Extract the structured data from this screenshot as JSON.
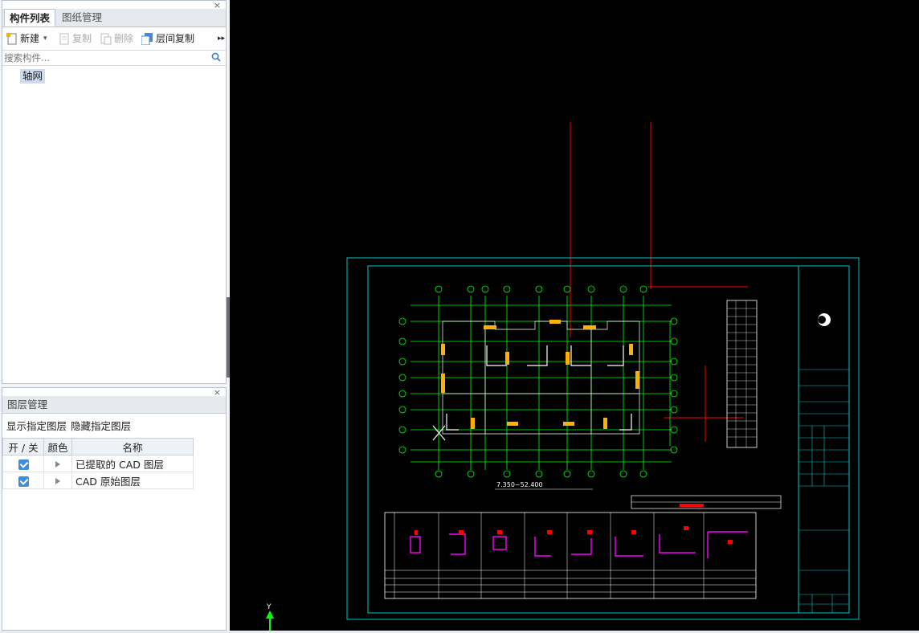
{
  "component_panel": {
    "close": "×",
    "tabs": [
      {
        "label": "构件列表",
        "active": true
      },
      {
        "label": "图纸管理",
        "active": false
      }
    ],
    "toolbar": {
      "new_label": "新建",
      "new_dropdown": "▾",
      "copy_label": "复制",
      "delete_label": "删除",
      "floor_copy_label": "层间复制",
      "more": "▸▸"
    },
    "search": {
      "placeholder": "搜索构件...",
      "value": ""
    },
    "tree": [
      {
        "label": "轴网",
        "selected": true
      }
    ]
  },
  "layer_panel": {
    "close": "×",
    "title": "图层管理",
    "show_label": "显示指定图层",
    "hide_label": "隐藏指定图层",
    "columns": [
      "开 / 关",
      "颜色",
      "名称"
    ],
    "rows": [
      {
        "on": true,
        "name": "已提取的 CAD 图层"
      },
      {
        "on": true,
        "name": "CAD 原始图层"
      }
    ]
  },
  "canvas": {
    "drawing_title": "7.350~52.400",
    "axis_label": "Y",
    "colors": {
      "background": "#000000",
      "frame": "#00c8c8",
      "grid": "#00ff00",
      "walls": "#ffffff",
      "red": "#ff0000",
      "column": "#ffb000",
      "magenta": "#ff00ff"
    }
  }
}
